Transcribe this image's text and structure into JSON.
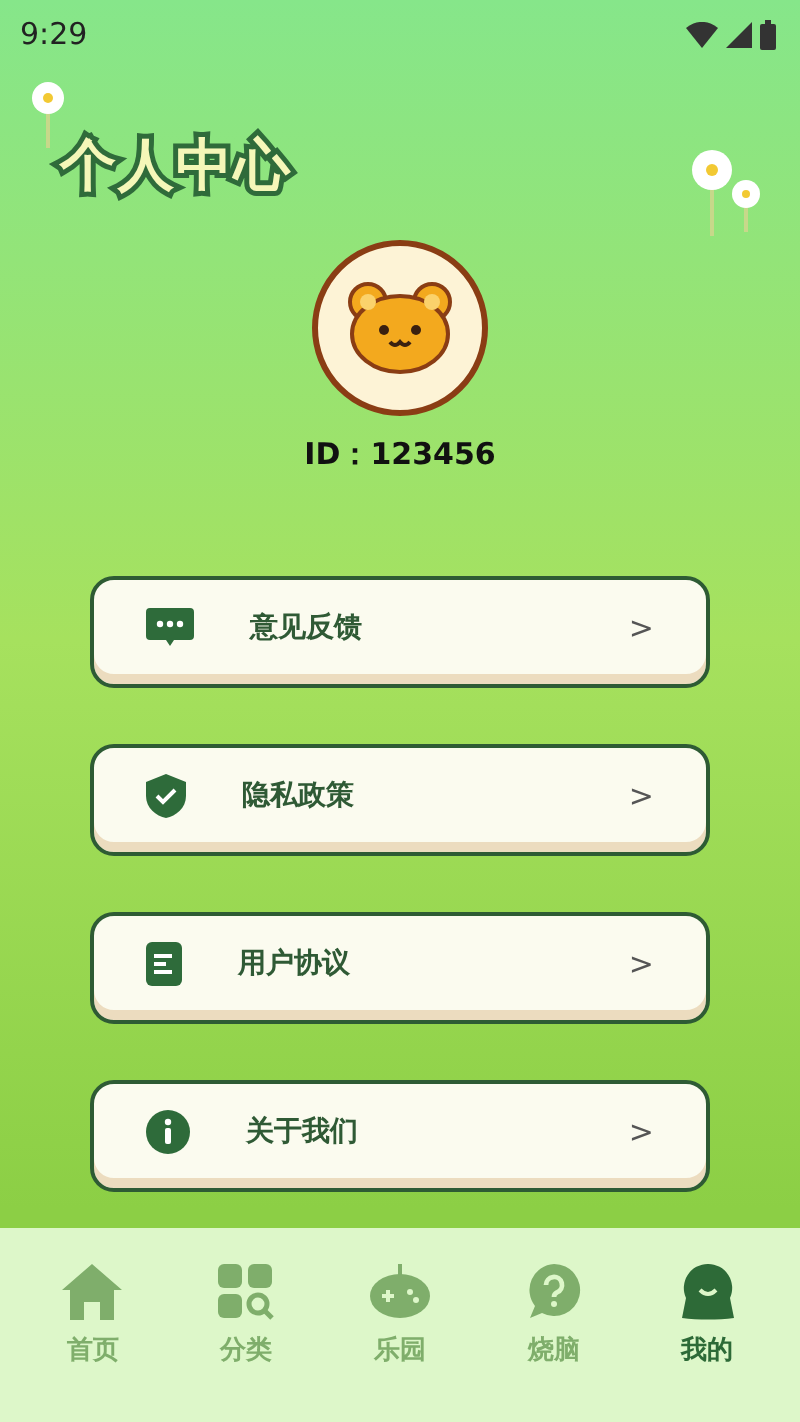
{
  "status_bar": {
    "time": "9:29"
  },
  "title": "个人中心",
  "profile": {
    "id_label": "ID：",
    "id_value": "123456"
  },
  "menu": [
    {
      "kind": "feedback",
      "label": "意见反馈",
      "chevron": ">"
    },
    {
      "kind": "privacy",
      "label": "隐私政策",
      "chevron": ">"
    },
    {
      "kind": "agreement",
      "label": "用户协议",
      "chevron": ">"
    },
    {
      "kind": "about",
      "label": "关于我们",
      "chevron": ">"
    }
  ],
  "tabs": [
    {
      "kind": "home",
      "label": "首页",
      "selected": false
    },
    {
      "kind": "category",
      "label": "分类",
      "selected": false
    },
    {
      "kind": "game",
      "label": "乐园",
      "selected": false
    },
    {
      "kind": "quiz",
      "label": "烧脑",
      "selected": false
    },
    {
      "kind": "me",
      "label": "我的",
      "selected": true
    }
  ]
}
